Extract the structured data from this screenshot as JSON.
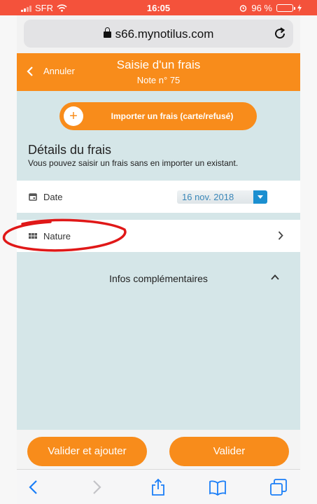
{
  "status_bar": {
    "carrier": "SFR",
    "time": "16:05",
    "battery_text": "96 %",
    "battery_level": 0.96,
    "accent_color": "#f4523b"
  },
  "browser": {
    "url": "s66.mynotilus.com",
    "icons": [
      "lock-icon",
      "reload-icon"
    ]
  },
  "header": {
    "back_label": "Annuler",
    "title": "Saisie d'un frais",
    "subtitle": "Note n° 75",
    "color": "#f88c1b"
  },
  "import_button": {
    "icon": "plus",
    "label": "Importer un frais (carte/refusé)"
  },
  "details": {
    "title": "Détails du frais",
    "subtitle": "Vous pouvez saisir un frais sans en importer un existant."
  },
  "fields": {
    "date": {
      "icon": "calendar-icon",
      "label": "Date",
      "value": "16 nov. 2018"
    },
    "nature": {
      "icon": "grid-icon",
      "label": "Nature"
    }
  },
  "infos": {
    "label": "Infos complémentaires"
  },
  "footer": {
    "add_label": "Valider et ajouter",
    "ok_label": "Valider"
  },
  "toolbar": {
    "icons": [
      "back-icon",
      "forward-icon",
      "share-icon",
      "bookmarks-icon",
      "tabs-icon"
    ]
  },
  "colors": {
    "page_bg": "#d5e6e8",
    "link_blue": "#1b8fd0",
    "annotation_red": "#e01818"
  }
}
